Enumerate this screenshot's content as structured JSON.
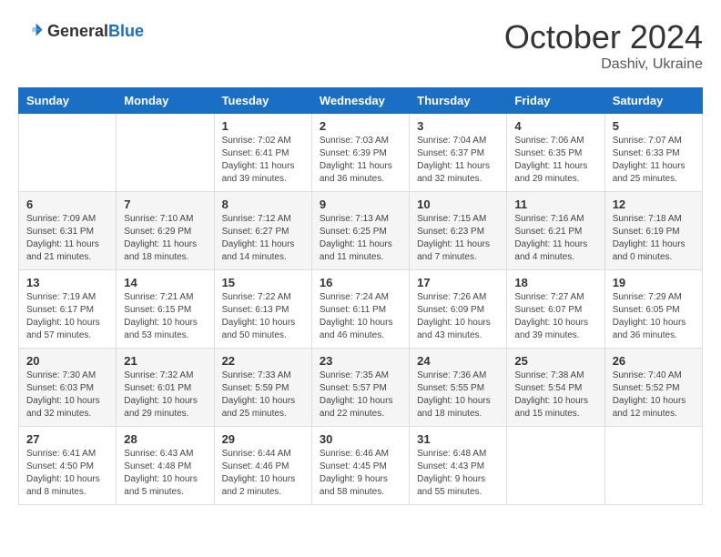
{
  "header": {
    "logo_general": "General",
    "logo_blue": "Blue",
    "month": "October 2024",
    "location": "Dashiv, Ukraine"
  },
  "days_of_week": [
    "Sunday",
    "Monday",
    "Tuesday",
    "Wednesday",
    "Thursday",
    "Friday",
    "Saturday"
  ],
  "weeks": [
    [
      {
        "day": null
      },
      {
        "day": null
      },
      {
        "day": "1",
        "sunrise": "Sunrise: 7:02 AM",
        "sunset": "Sunset: 6:41 PM",
        "daylight": "Daylight: 11 hours and 39 minutes."
      },
      {
        "day": "2",
        "sunrise": "Sunrise: 7:03 AM",
        "sunset": "Sunset: 6:39 PM",
        "daylight": "Daylight: 11 hours and 36 minutes."
      },
      {
        "day": "3",
        "sunrise": "Sunrise: 7:04 AM",
        "sunset": "Sunset: 6:37 PM",
        "daylight": "Daylight: 11 hours and 32 minutes."
      },
      {
        "day": "4",
        "sunrise": "Sunrise: 7:06 AM",
        "sunset": "Sunset: 6:35 PM",
        "daylight": "Daylight: 11 hours and 29 minutes."
      },
      {
        "day": "5",
        "sunrise": "Sunrise: 7:07 AM",
        "sunset": "Sunset: 6:33 PM",
        "daylight": "Daylight: 11 hours and 25 minutes."
      }
    ],
    [
      {
        "day": "6",
        "sunrise": "Sunrise: 7:09 AM",
        "sunset": "Sunset: 6:31 PM",
        "daylight": "Daylight: 11 hours and 21 minutes."
      },
      {
        "day": "7",
        "sunrise": "Sunrise: 7:10 AM",
        "sunset": "Sunset: 6:29 PM",
        "daylight": "Daylight: 11 hours and 18 minutes."
      },
      {
        "day": "8",
        "sunrise": "Sunrise: 7:12 AM",
        "sunset": "Sunset: 6:27 PM",
        "daylight": "Daylight: 11 hours and 14 minutes."
      },
      {
        "day": "9",
        "sunrise": "Sunrise: 7:13 AM",
        "sunset": "Sunset: 6:25 PM",
        "daylight": "Daylight: 11 hours and 11 minutes."
      },
      {
        "day": "10",
        "sunrise": "Sunrise: 7:15 AM",
        "sunset": "Sunset: 6:23 PM",
        "daylight": "Daylight: 11 hours and 7 minutes."
      },
      {
        "day": "11",
        "sunrise": "Sunrise: 7:16 AM",
        "sunset": "Sunset: 6:21 PM",
        "daylight": "Daylight: 11 hours and 4 minutes."
      },
      {
        "day": "12",
        "sunrise": "Sunrise: 7:18 AM",
        "sunset": "Sunset: 6:19 PM",
        "daylight": "Daylight: 11 hours and 0 minutes."
      }
    ],
    [
      {
        "day": "13",
        "sunrise": "Sunrise: 7:19 AM",
        "sunset": "Sunset: 6:17 PM",
        "daylight": "Daylight: 10 hours and 57 minutes."
      },
      {
        "day": "14",
        "sunrise": "Sunrise: 7:21 AM",
        "sunset": "Sunset: 6:15 PM",
        "daylight": "Daylight: 10 hours and 53 minutes."
      },
      {
        "day": "15",
        "sunrise": "Sunrise: 7:22 AM",
        "sunset": "Sunset: 6:13 PM",
        "daylight": "Daylight: 10 hours and 50 minutes."
      },
      {
        "day": "16",
        "sunrise": "Sunrise: 7:24 AM",
        "sunset": "Sunset: 6:11 PM",
        "daylight": "Daylight: 10 hours and 46 minutes."
      },
      {
        "day": "17",
        "sunrise": "Sunrise: 7:26 AM",
        "sunset": "Sunset: 6:09 PM",
        "daylight": "Daylight: 10 hours and 43 minutes."
      },
      {
        "day": "18",
        "sunrise": "Sunrise: 7:27 AM",
        "sunset": "Sunset: 6:07 PM",
        "daylight": "Daylight: 10 hours and 39 minutes."
      },
      {
        "day": "19",
        "sunrise": "Sunrise: 7:29 AM",
        "sunset": "Sunset: 6:05 PM",
        "daylight": "Daylight: 10 hours and 36 minutes."
      }
    ],
    [
      {
        "day": "20",
        "sunrise": "Sunrise: 7:30 AM",
        "sunset": "Sunset: 6:03 PM",
        "daylight": "Daylight: 10 hours and 32 minutes."
      },
      {
        "day": "21",
        "sunrise": "Sunrise: 7:32 AM",
        "sunset": "Sunset: 6:01 PM",
        "daylight": "Daylight: 10 hours and 29 minutes."
      },
      {
        "day": "22",
        "sunrise": "Sunrise: 7:33 AM",
        "sunset": "Sunset: 5:59 PM",
        "daylight": "Daylight: 10 hours and 25 minutes."
      },
      {
        "day": "23",
        "sunrise": "Sunrise: 7:35 AM",
        "sunset": "Sunset: 5:57 PM",
        "daylight": "Daylight: 10 hours and 22 minutes."
      },
      {
        "day": "24",
        "sunrise": "Sunrise: 7:36 AM",
        "sunset": "Sunset: 5:55 PM",
        "daylight": "Daylight: 10 hours and 18 minutes."
      },
      {
        "day": "25",
        "sunrise": "Sunrise: 7:38 AM",
        "sunset": "Sunset: 5:54 PM",
        "daylight": "Daylight: 10 hours and 15 minutes."
      },
      {
        "day": "26",
        "sunrise": "Sunrise: 7:40 AM",
        "sunset": "Sunset: 5:52 PM",
        "daylight": "Daylight: 10 hours and 12 minutes."
      }
    ],
    [
      {
        "day": "27",
        "sunrise": "Sunrise: 6:41 AM",
        "sunset": "Sunset: 4:50 PM",
        "daylight": "Daylight: 10 hours and 8 minutes."
      },
      {
        "day": "28",
        "sunrise": "Sunrise: 6:43 AM",
        "sunset": "Sunset: 4:48 PM",
        "daylight": "Daylight: 10 hours and 5 minutes."
      },
      {
        "day": "29",
        "sunrise": "Sunrise: 6:44 AM",
        "sunset": "Sunset: 4:46 PM",
        "daylight": "Daylight: 10 hours and 2 minutes."
      },
      {
        "day": "30",
        "sunrise": "Sunrise: 6:46 AM",
        "sunset": "Sunset: 4:45 PM",
        "daylight": "Daylight: 9 hours and 58 minutes."
      },
      {
        "day": "31",
        "sunrise": "Sunrise: 6:48 AM",
        "sunset": "Sunset: 4:43 PM",
        "daylight": "Daylight: 9 hours and 55 minutes."
      },
      {
        "day": null
      },
      {
        "day": null
      }
    ]
  ]
}
